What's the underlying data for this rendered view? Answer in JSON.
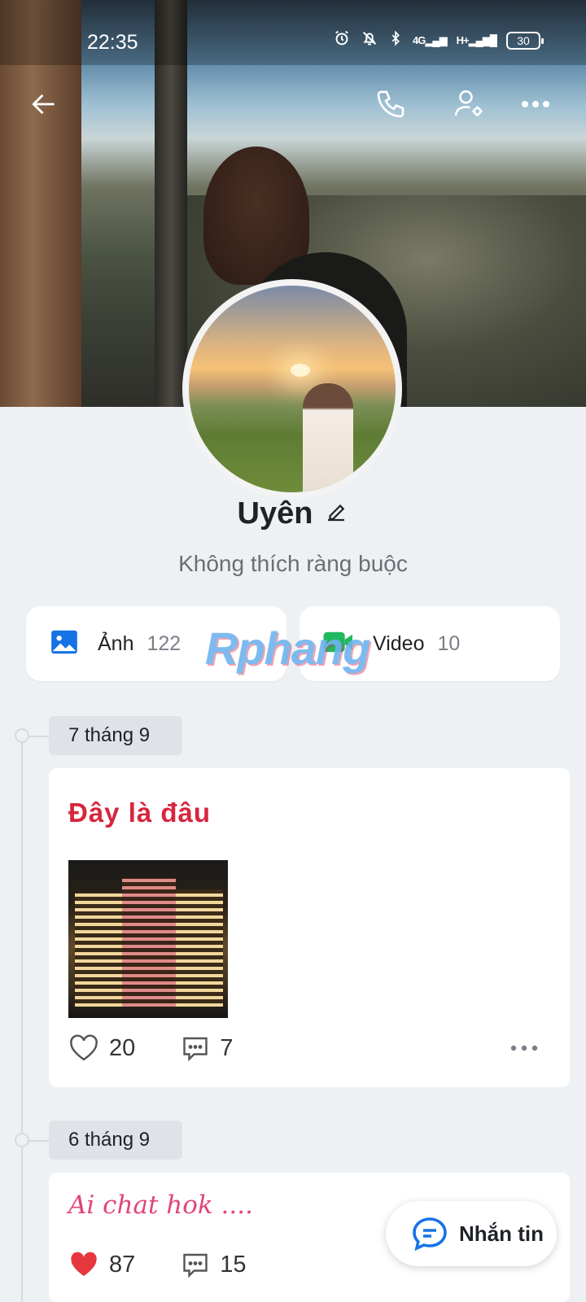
{
  "status": {
    "time": "22:35",
    "battery": "30",
    "network_a": "4G",
    "network_b": "H+"
  },
  "header": {
    "back_icon": "arrow-left-icon",
    "call_icon": "phone-icon",
    "settings_icon": "user-settings-icon",
    "more_icon": "more-horizontal-icon"
  },
  "profile": {
    "name": "Uyên",
    "bio": "Không thích ràng buộc"
  },
  "media": {
    "photos": {
      "label": "Ảnh",
      "count": "122",
      "icon": "image-icon"
    },
    "videos": {
      "label": "Video",
      "count": "10",
      "icon": "video-icon"
    }
  },
  "watermark": "Rphang",
  "feed": [
    {
      "date": "7 tháng 9",
      "title": "Đây là đâu",
      "likes": "20",
      "comments": "7",
      "liked": false
    },
    {
      "date": "6 tháng 9",
      "title": "Ai chat hok ....",
      "likes": "87",
      "comments": "15",
      "liked": true
    }
  ],
  "fab": {
    "label": "Nhắn tin",
    "icon": "chat-bubble-icon"
  },
  "colors": {
    "accent": "#0068ff",
    "title_red": "#d7263d",
    "heart_red": "#e5373d",
    "pink": "#e0457b"
  }
}
